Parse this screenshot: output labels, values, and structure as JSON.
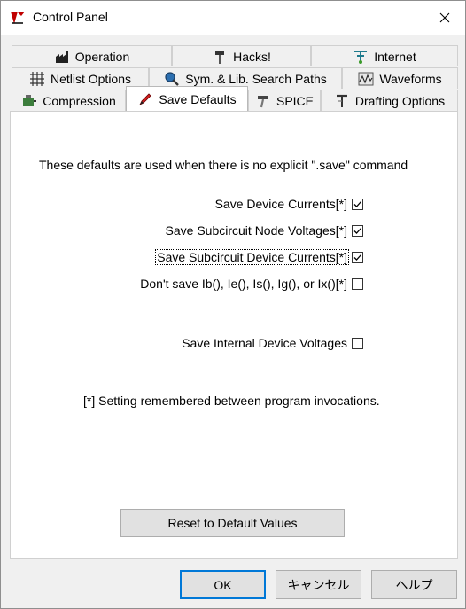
{
  "window": {
    "title": "Control Panel"
  },
  "tabs": {
    "row1": [
      {
        "label": "Operation",
        "icon": "factory-icon"
      },
      {
        "label": "Hacks!",
        "icon": "hammer-icon"
      },
      {
        "label": "Internet",
        "icon": "network-icon"
      }
    ],
    "row2": [
      {
        "label": "Netlist Options",
        "icon": "grid-icon"
      },
      {
        "label": "Sym. & Lib. Search Paths",
        "icon": "magnifier-icon"
      },
      {
        "label": "Waveforms",
        "icon": "waveform-icon"
      }
    ],
    "row3": [
      {
        "label": "Compression",
        "icon": "compressor-icon"
      },
      {
        "label": "Save Defaults",
        "icon": "pen-icon",
        "selected": true
      },
      {
        "label": "SPICE",
        "icon": "hammer-icon"
      },
      {
        "label": "Drafting Options",
        "icon": "drafting-icon"
      }
    ]
  },
  "panel": {
    "intro": "These defaults are used when there is no explicit \".save\" command",
    "options": [
      {
        "label": "Save Device Currents[*]",
        "checked": true
      },
      {
        "label": "Save Subcircuit Node Voltages[*]",
        "checked": true
      },
      {
        "label": "Save Subcircuit Device Currents[*]",
        "checked": true,
        "focused": true
      },
      {
        "label": "Don't save Ib(), Ie(), Is(), Ig(), or Ix()[*]",
        "checked": false
      },
      {
        "label": "Save Internal Device Voltages",
        "checked": false
      }
    ],
    "note": "[*] Setting remembered between program invocations.",
    "reset_label": "Reset to Default Values"
  },
  "buttons": {
    "ok": "OK",
    "cancel": "キャンセル",
    "help": "ヘルプ"
  }
}
